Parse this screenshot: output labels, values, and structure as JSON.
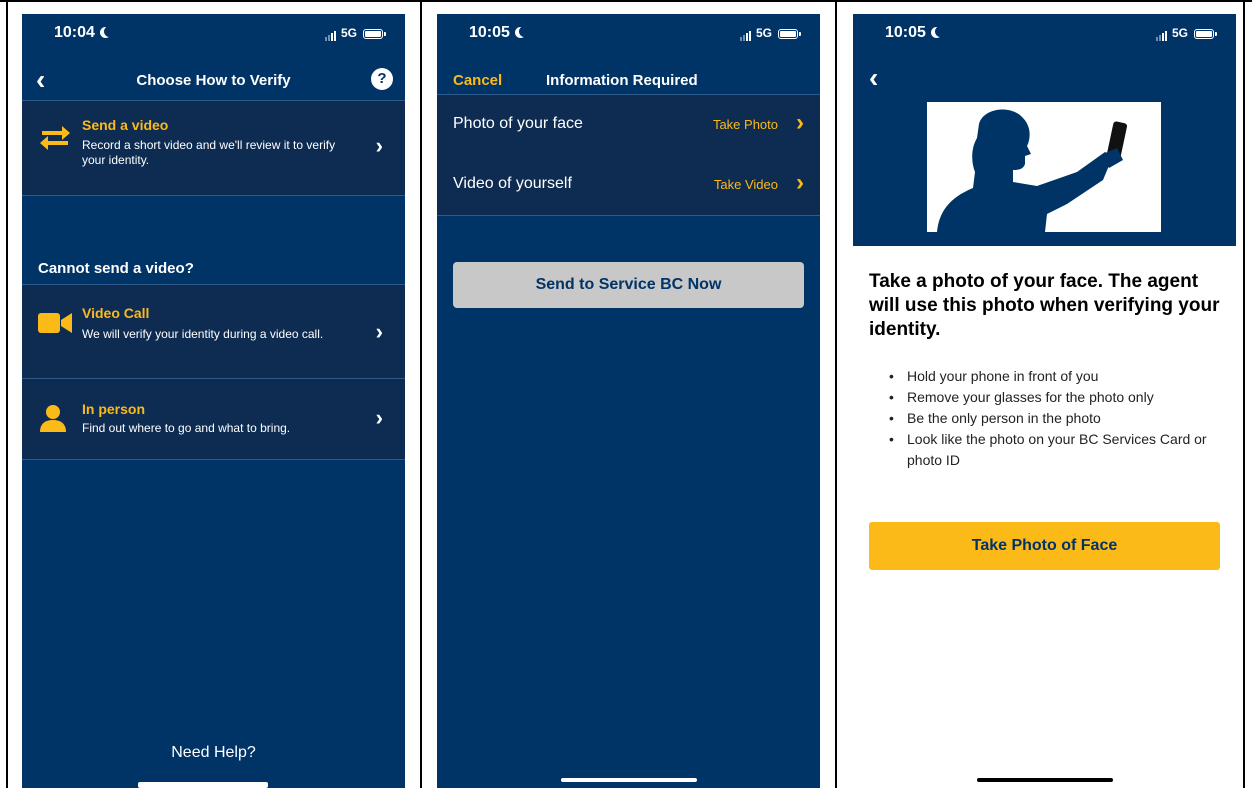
{
  "screen1": {
    "status": {
      "time": "10:04",
      "network": "5G"
    },
    "title": "Choose How to Verify",
    "help_glyph": "?",
    "option_video": {
      "title": "Send a video",
      "desc": "Record a short video and we'll review it to verify your identity."
    },
    "section_heading": "Cannot send a video?",
    "option_call": {
      "title": "Video Call",
      "desc": "We will verify your identity during a video call."
    },
    "option_person": {
      "title": "In person",
      "desc": "Find out where to go and what to bring."
    },
    "need_help": "Need Help?"
  },
  "screen2": {
    "status": {
      "time": "10:05",
      "network": "5G"
    },
    "cancel": "Cancel",
    "title": "Information Required",
    "rows": [
      {
        "label": "Photo of your face",
        "action": "Take Photo"
      },
      {
        "label": "Video of yourself",
        "action": "Take Video"
      }
    ],
    "send_button": "Send to Service BC Now"
  },
  "screen3": {
    "status": {
      "time": "10:05",
      "network": "5G"
    },
    "heading": "Take a photo of your face. The agent will use this photo when verifying your identity.",
    "bullets": [
      "Hold your phone in front of you",
      "Remove your glasses for the photo only",
      "Be the only person in the photo",
      "Look like the photo on your BC Services Card or photo ID"
    ],
    "button": "Take Photo of Face"
  },
  "colors": {
    "navy": "#003366",
    "row": "#0e2c52",
    "accent": "#fcba19",
    "button_gray": "#c8c8c8"
  },
  "icons": [
    "chevron-left-icon",
    "help-circle-icon",
    "swap-arrows-icon",
    "video-camera-icon",
    "person-icon",
    "chevron-right-icon",
    "signal-icon",
    "battery-icon",
    "moon-icon"
  ]
}
